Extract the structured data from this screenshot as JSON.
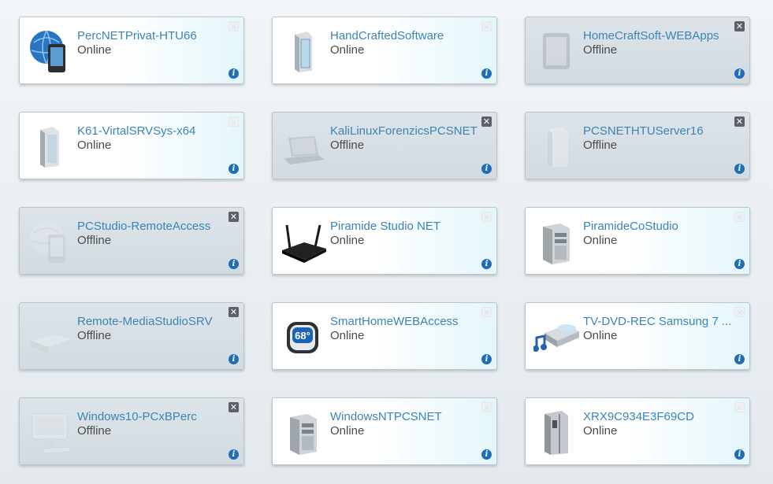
{
  "colors": {
    "name_link": "#3a84b6",
    "status_text": "#4b4b4b",
    "info_badge": "#1f6fb8"
  },
  "icons": {
    "close": "✕",
    "info": "i"
  },
  "devices": [
    {
      "name": "PercNETPrivat-HTU66",
      "status": "Online",
      "icon": "phone-globe-icon"
    },
    {
      "name": "HandCraftedSoftware",
      "status": "Online",
      "icon": "server-icon"
    },
    {
      "name": "HomeCraftSoft-WEBApps",
      "status": "Offline",
      "icon": "tablet-icon"
    },
    {
      "name": "K61-VirtalSRVSys-x64",
      "status": "Online",
      "icon": "server-icon"
    },
    {
      "name": "KaliLinuxForenzicsPCSNET",
      "status": "Offline",
      "icon": "laptop-icon"
    },
    {
      "name": "PCSNETHTUServer16",
      "status": "Offline",
      "icon": "server-icon"
    },
    {
      "name": "PCStudio-RemoteAccess",
      "status": "Offline",
      "icon": "phone-globe-icon"
    },
    {
      "name": "Piramide Studio NET",
      "status": "Online",
      "icon": "router-icon"
    },
    {
      "name": "PiramideCoStudio",
      "status": "Online",
      "icon": "tower-pc-icon"
    },
    {
      "name": "Remote-MediaStudioSRV",
      "status": "Offline",
      "icon": "media-box-icon"
    },
    {
      "name": "SmartHomeWEBAccess",
      "status": "Online",
      "icon": "thermostat-icon"
    },
    {
      "name": "TV-DVD-REC Samsung 7 ...",
      "status": "Online",
      "icon": "media-player-icon"
    },
    {
      "name": "Windows10-PCxBPerc",
      "status": "Offline",
      "icon": "imac-icon"
    },
    {
      "name": "WindowsNTPCSNET",
      "status": "Online",
      "icon": "tower-pc-icon"
    },
    {
      "name": "XRX9C934E3F69CD",
      "status": "Online",
      "icon": "fridge-icon"
    }
  ]
}
